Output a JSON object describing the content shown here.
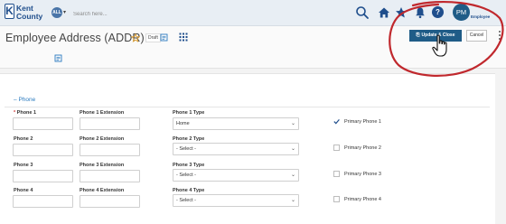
{
  "topbar": {
    "logo_line1": "Kent",
    "logo_line2": "County",
    "logo_letter": "K",
    "scope_badge": "ALL",
    "search_placeholder": "Search here...",
    "user_initials": "PM",
    "user_label": "Employee"
  },
  "header": {
    "title": "Employee Address (ADDR)",
    "status_badge": "Draft",
    "update_close_label": "Update & Close",
    "cancel_label": "Cancel"
  },
  "section": {
    "title": "Phone",
    "toggle_glyph": "–"
  },
  "rows": [
    {
      "phone_label": "Phone 1",
      "required": true,
      "ext_label": "Phone 1 Extension",
      "type_label": "Phone 1 Type",
      "type_value": "Home",
      "primary_label": "Primary Phone 1",
      "primary_checked": true
    },
    {
      "phone_label": "Phone 2",
      "required": false,
      "ext_label": "Phone 2 Extension",
      "type_label": "Phone 2 Type",
      "type_value": "- Select -",
      "primary_label": "Primary Phone 2",
      "primary_checked": false
    },
    {
      "phone_label": "Phone 3",
      "required": false,
      "ext_label": "Phone 3 Extension",
      "type_label": "Phone 3 Type",
      "type_value": "- Select -",
      "primary_label": "Primary Phone 3",
      "primary_checked": false
    },
    {
      "phone_label": "Phone 4",
      "required": false,
      "ext_label": "Phone 4 Extension",
      "type_label": "Phone 4 Type",
      "type_value": "- Select -",
      "primary_label": "Primary Phone 4",
      "primary_checked": false
    }
  ],
  "colors": {
    "brand": "#1f4e8c",
    "primary_button": "#1f5c87",
    "annotation": "#c0282d",
    "link": "#2b7bbf"
  }
}
